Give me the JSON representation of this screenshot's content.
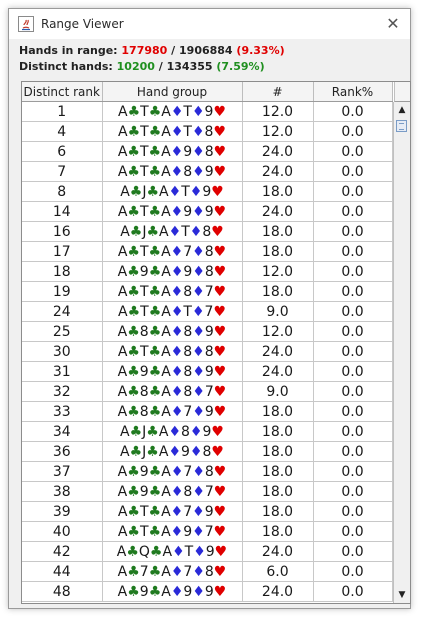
{
  "window": {
    "title": "Range Viewer",
    "close_glyph": "✕"
  },
  "stats": {
    "hands_label": "Hands in range: ",
    "hands_in_range": "177980",
    "hands_total": " / 1906884 ",
    "hands_pct": "(9.33%)",
    "distinct_label": "Distinct hands: ",
    "distinct_count": "10200",
    "distinct_total": " / 134355 ",
    "distinct_pct": "(7.59%)"
  },
  "columns": [
    "Distinct rank",
    "Hand group",
    "#",
    "Rank%"
  ],
  "suit_colors": {
    "c": "#1f7a1f",
    "d": "#2a2ad8",
    "h": "#e00000"
  },
  "rows": [
    {
      "rank": "1",
      "hand": "A♣T♣A♦T♦9♥",
      "count": "12.0",
      "pct": "0.0"
    },
    {
      "rank": "4",
      "hand": "A♣T♣A♦T♦8♥",
      "count": "12.0",
      "pct": "0.0"
    },
    {
      "rank": "6",
      "hand": "A♣T♣A♦9♦8♥",
      "count": "24.0",
      "pct": "0.0"
    },
    {
      "rank": "7",
      "hand": "A♣T♣A♦8♦9♥",
      "count": "24.0",
      "pct": "0.0"
    },
    {
      "rank": "8",
      "hand": "A♣J♣A♦T♦9♥",
      "count": "18.0",
      "pct": "0.0"
    },
    {
      "rank": "14",
      "hand": "A♣T♣A♦9♦9♥",
      "count": "24.0",
      "pct": "0.0"
    },
    {
      "rank": "16",
      "hand": "A♣J♣A♦T♦8♥",
      "count": "18.0",
      "pct": "0.0"
    },
    {
      "rank": "17",
      "hand": "A♣T♣A♦7♦8♥",
      "count": "18.0",
      "pct": "0.0"
    },
    {
      "rank": "18",
      "hand": "A♣9♣A♦9♦8♥",
      "count": "12.0",
      "pct": "0.0"
    },
    {
      "rank": "19",
      "hand": "A♣T♣A♦8♦7♥",
      "count": "18.0",
      "pct": "0.0"
    },
    {
      "rank": "24",
      "hand": "A♣T♣A♦T♦7♥",
      "count": "9.0",
      "pct": "0.0"
    },
    {
      "rank": "25",
      "hand": "A♣8♣A♦8♦9♥",
      "count": "12.0",
      "pct": "0.0"
    },
    {
      "rank": "30",
      "hand": "A♣T♣A♦8♦8♥",
      "count": "24.0",
      "pct": "0.0"
    },
    {
      "rank": "31",
      "hand": "A♣9♣A♦8♦9♥",
      "count": "24.0",
      "pct": "0.0"
    },
    {
      "rank": "32",
      "hand": "A♣8♣A♦8♦7♥",
      "count": "9.0",
      "pct": "0.0"
    },
    {
      "rank": "33",
      "hand": "A♣8♣A♦7♦9♥",
      "count": "18.0",
      "pct": "0.0"
    },
    {
      "rank": "34",
      "hand": "A♣J♣A♦8♦9♥",
      "count": "18.0",
      "pct": "0.0"
    },
    {
      "rank": "36",
      "hand": "A♣J♣A♦9♦8♥",
      "count": "18.0",
      "pct": "0.0"
    },
    {
      "rank": "37",
      "hand": "A♣9♣A♦7♦8♥",
      "count": "18.0",
      "pct": "0.0"
    },
    {
      "rank": "38",
      "hand": "A♣9♣A♦8♦7♥",
      "count": "18.0",
      "pct": "0.0"
    },
    {
      "rank": "39",
      "hand": "A♣T♣A♦7♦9♥",
      "count": "18.0",
      "pct": "0.0"
    },
    {
      "rank": "40",
      "hand": "A♣T♣A♦9♦7♥",
      "count": "18.0",
      "pct": "0.0"
    },
    {
      "rank": "42",
      "hand": "A♣Q♣A♦T♦9♥",
      "count": "24.0",
      "pct": "0.0"
    },
    {
      "rank": "44",
      "hand": "A♣7♣A♦7♦8♥",
      "count": "6.0",
      "pct": "0.0"
    },
    {
      "rank": "48",
      "hand": "A♣9♣A♦9♦9♥",
      "count": "24.0",
      "pct": "0.0"
    }
  ],
  "scrollbar": {
    "up_glyph": "▲",
    "down_glyph": "▼"
  }
}
